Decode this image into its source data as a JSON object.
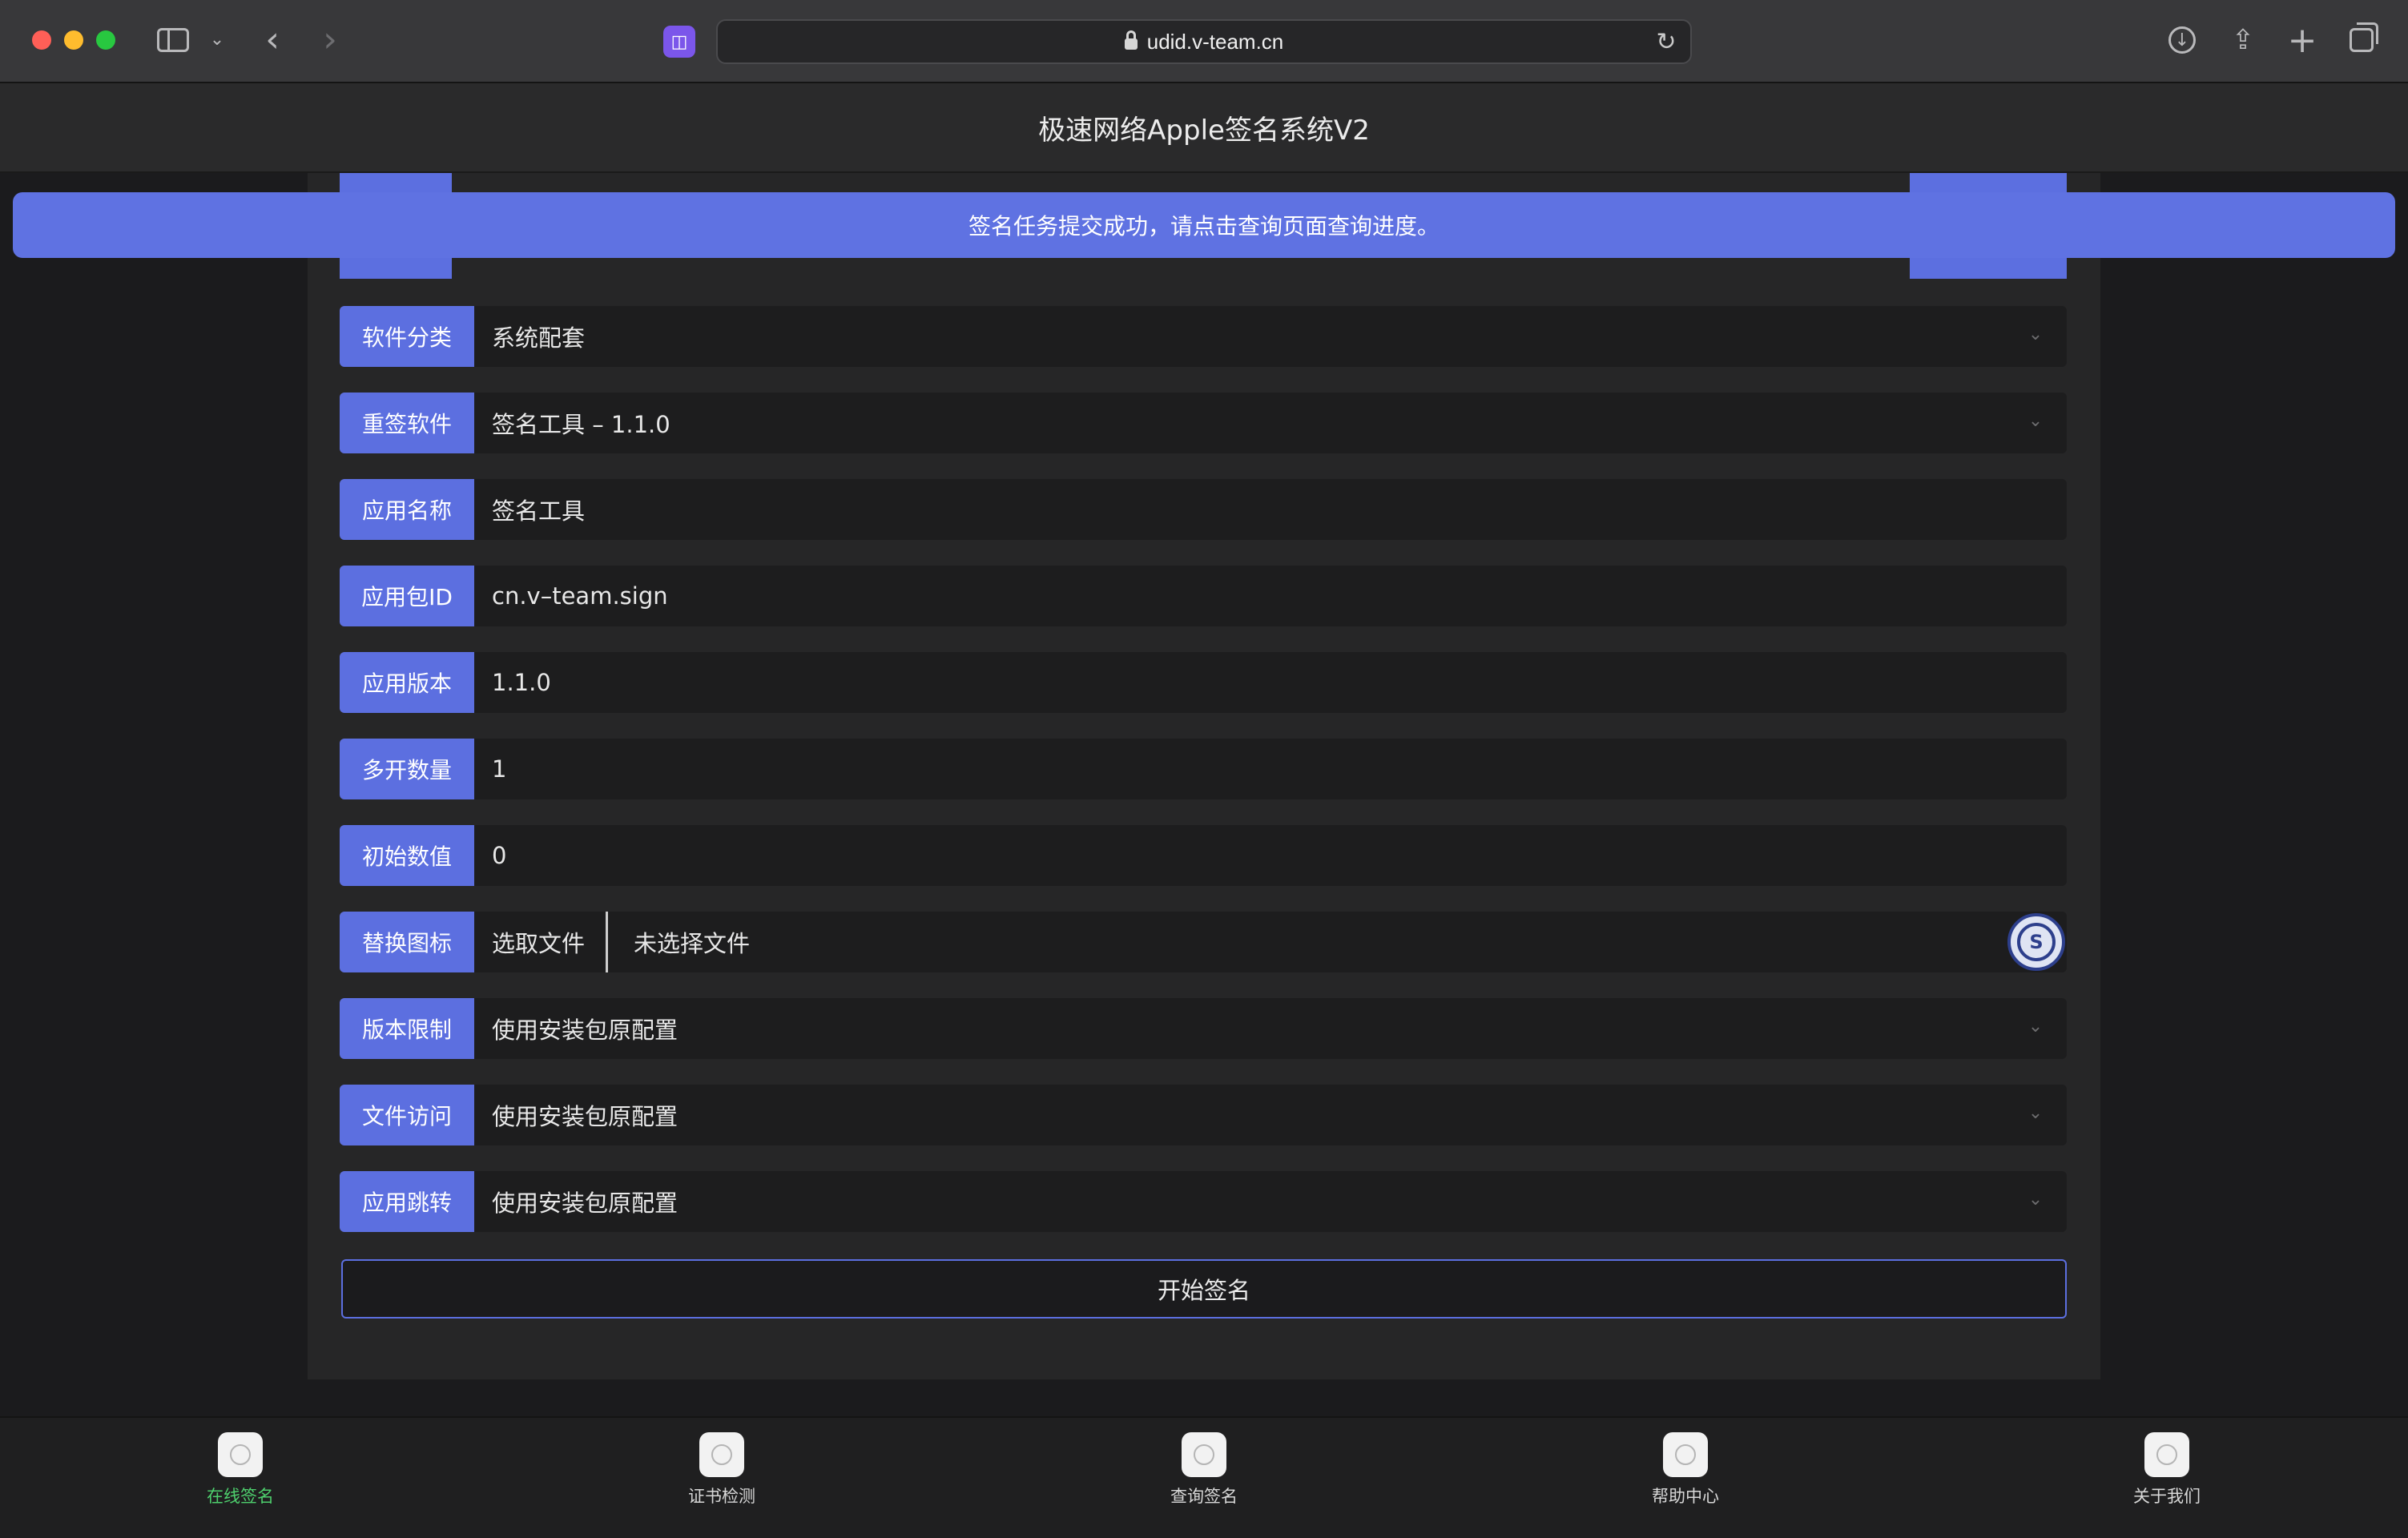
{
  "browser": {
    "url": "udid.v-team.cn",
    "icons": {
      "sidebar": "sidebar-icon",
      "back": "chevron-left-icon",
      "forward": "chevron-right-icon",
      "extension": "extension-icon",
      "lock": "lock-icon",
      "reload": "reload-icon",
      "download": "download-icon",
      "share": "share-icon",
      "new_tab": "plus-icon",
      "tabs": "tab-overview-icon"
    }
  },
  "header": {
    "title": "极速网络Apple签名系统V2"
  },
  "toast": {
    "message": "签名任务提交成功，请点击查询页面查询进度。"
  },
  "form": {
    "rows": [
      {
        "label": "软件分类",
        "value": "系统配套",
        "type": "select"
      },
      {
        "label": "重签软件",
        "value": "签名工具 – 1.1.0",
        "type": "select"
      },
      {
        "label": "应用名称",
        "value": "签名工具",
        "type": "input"
      },
      {
        "label": "应用包ID",
        "value": "cn.v–team.sign",
        "type": "input"
      },
      {
        "label": "应用版本",
        "value": "1.1.0",
        "type": "input"
      },
      {
        "label": "多开数量",
        "value": "1",
        "type": "input"
      },
      {
        "label": "初始数值",
        "value": "0",
        "type": "input"
      },
      {
        "label": "替换图标",
        "choose_label": "选取文件",
        "file_status": "未选择文件",
        "type": "file"
      },
      {
        "label": "版本限制",
        "value": "使用安装包原配置",
        "type": "select"
      },
      {
        "label": "文件访问",
        "value": "使用安装包原配置",
        "type": "select"
      },
      {
        "label": "应用跳转",
        "value": "使用安装包原配置",
        "type": "select"
      }
    ],
    "submit_label": "开始签名"
  },
  "tabbar": {
    "tabs": [
      {
        "label": "在线签名",
        "active": true
      },
      {
        "label": "证书检测",
        "active": false
      },
      {
        "label": "查询签名",
        "active": false
      },
      {
        "label": "帮助中心",
        "active": false
      },
      {
        "label": "关于我们",
        "active": false
      }
    ]
  },
  "colors": {
    "accent": "#5c6fe0",
    "toast": "#5f72e2",
    "active_tab": "#4ecf6d",
    "page_bg": "#1b1b1d"
  }
}
